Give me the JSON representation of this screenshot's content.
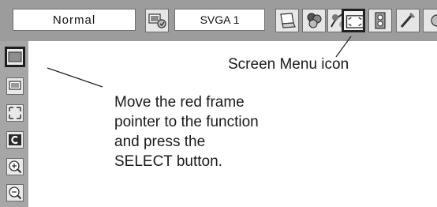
{
  "menu_bar": {
    "mode_value": "Normal",
    "source_value": "SVGA 1",
    "icons": [
      "auto-pc-adjust-icon",
      "laptop-input-icon",
      "color-select-icon",
      "image-adjust-icon",
      "screen-icon",
      "sound-icon",
      "setting-icon",
      "information-icon"
    ]
  },
  "side_menu": {
    "icons": [
      "normal-screen-icon",
      "full-screen-icon",
      "true-screen-icon",
      "custom-screen-icon",
      "digital-zoom-plus-icon",
      "digital-zoom-minus-icon"
    ]
  },
  "annotations": {
    "screen_menu_label": "Screen Menu icon",
    "instruction_lines": [
      "Move the red frame",
      "pointer to the function",
      "and press the",
      "SELECT button."
    ]
  }
}
